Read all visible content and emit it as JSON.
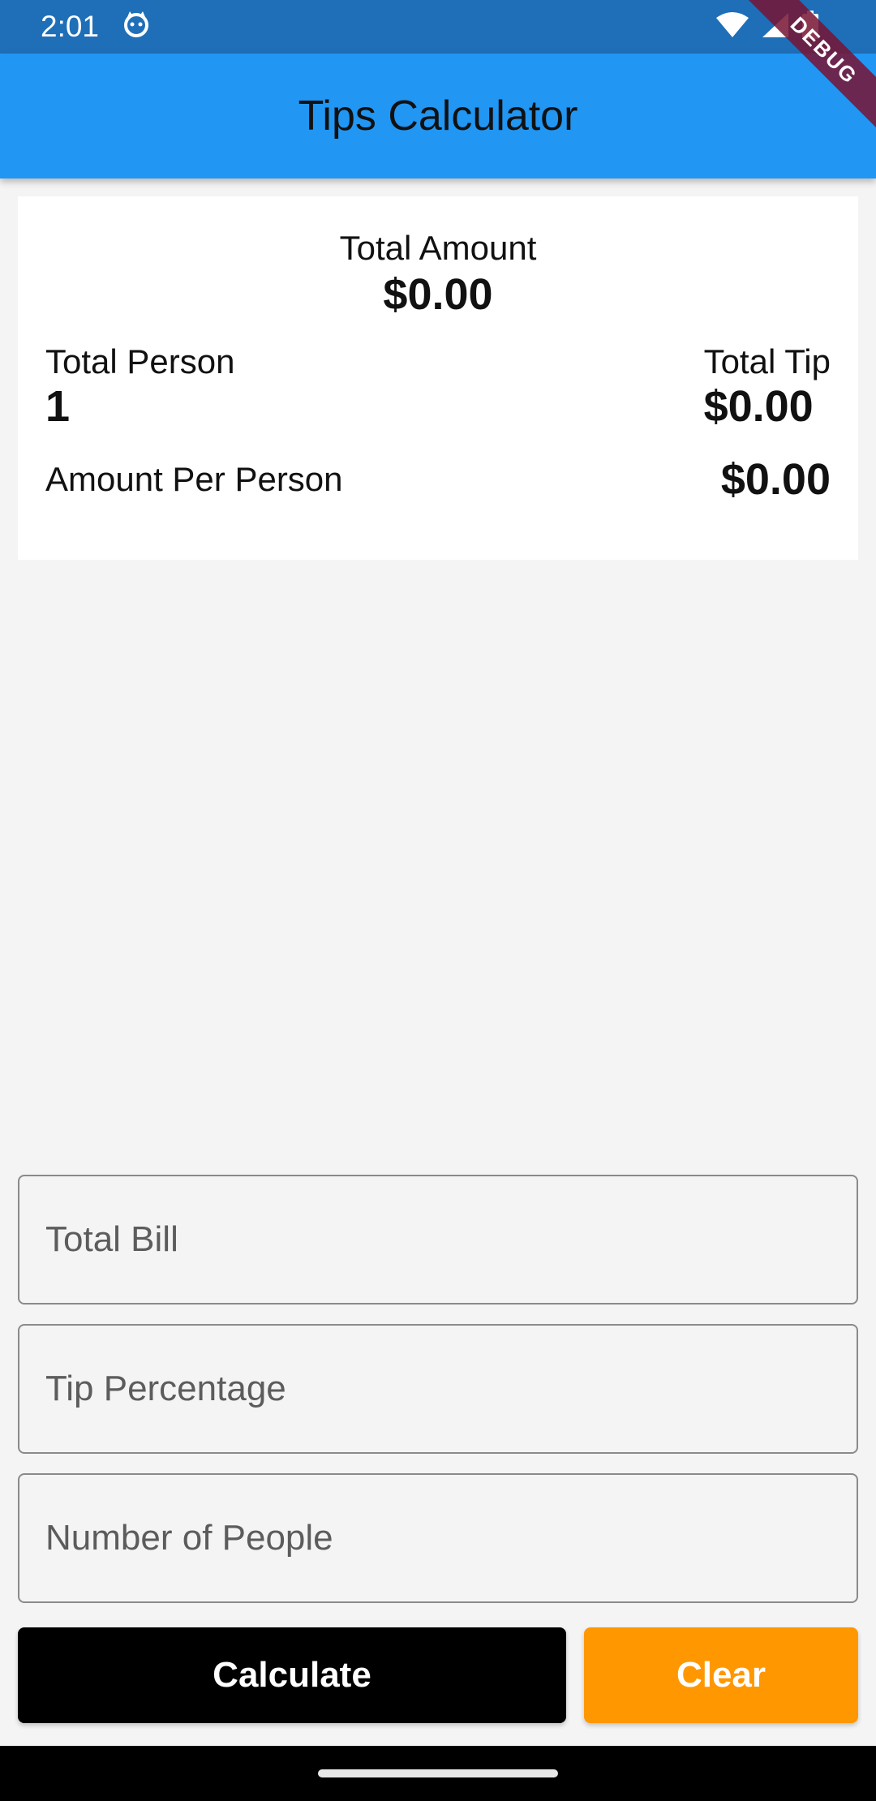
{
  "status_bar": {
    "time": "2:01",
    "icons": [
      "cat-notification-icon",
      "wifi-icon",
      "signal-icon",
      "battery-icon"
    ]
  },
  "debug_banner": "DEBUG",
  "app_bar": {
    "title": "Tips Calculator",
    "color": "#2196f3"
  },
  "summary": {
    "total_amount_label": "Total Amount",
    "total_amount_value": "$0.00",
    "total_person_label": "Total Person",
    "total_person_value": "1",
    "total_tip_label": "Total Tip",
    "total_tip_value": "$0.00",
    "per_person_label": "Amount Per Person",
    "per_person_value": "$0.00"
  },
  "form": {
    "total_bill": {
      "placeholder": "Total Bill",
      "value": ""
    },
    "tip_percentage": {
      "placeholder": "Tip Percentage",
      "value": ""
    },
    "num_people": {
      "placeholder": "Number of People",
      "value": ""
    }
  },
  "buttons": {
    "calculate_label": "Calculate",
    "clear_label": "Clear",
    "calculate_color": "#000000",
    "clear_color": "#ff9800"
  }
}
